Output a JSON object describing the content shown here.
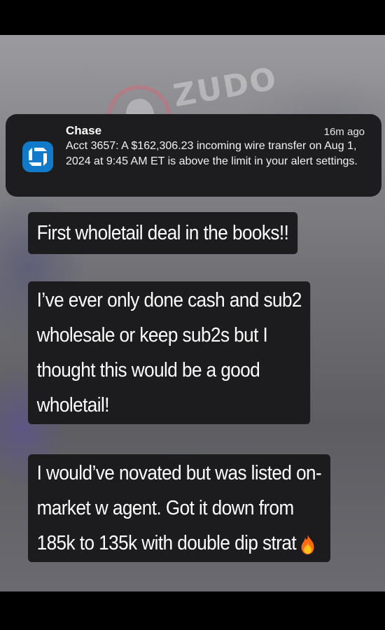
{
  "notification": {
    "app_name": "Chase",
    "time": "16m ago",
    "message": "Acct 3657: A $162,306.23 incoming wire transfer on Aug 1, 2024 at 9:45 AM ET is above the limit in your alert settings.",
    "icon": "chase-logo-icon",
    "icon_color": "#117aca"
  },
  "watermark": {
    "text": "ZUDO"
  },
  "captions": [
    {
      "lines": [
        "First wholetail deal in the books!!"
      ]
    },
    {
      "lines": [
        "I’ve ever only done cash and sub2",
        "wholesale or keep sub2s but I",
        "thought this would be a good",
        "wholetail!"
      ]
    },
    {
      "lines": [
        "I would’ve novated but was listed on-",
        "market w agent. Got it down from",
        "185k to 135k with double dip strat"
      ],
      "emoji": "fire-emoji-icon"
    }
  ]
}
